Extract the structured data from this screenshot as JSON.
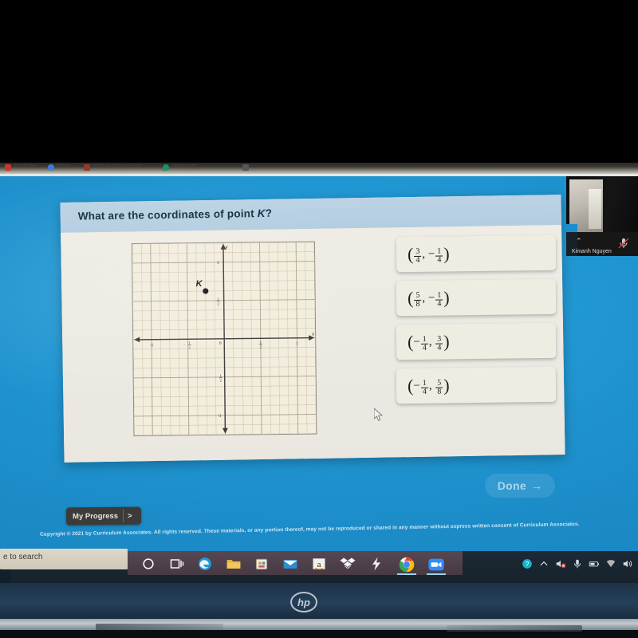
{
  "browser": {
    "bookmarks": [
      {
        "label": "YouTube",
        "icon": "youtube-icon",
        "color": "#c8372d"
      },
      {
        "label": "Maps",
        "icon": "maps-icon",
        "color": "#3b7ddd"
      },
      {
        "label": "Math Academy Link",
        "icon": "book-icon",
        "color": "#8d3b2e"
      },
      {
        "label": "iready.org",
        "icon": "iready-icon",
        "color": "#1f8f6a"
      },
      {
        "label": "",
        "icon": "folder-icon",
        "color": "#6b6b6b"
      }
    ]
  },
  "question": {
    "prompt_before": "What are the coordinates of point ",
    "prompt_var": "K",
    "prompt_after": "?"
  },
  "graph": {
    "x_axis_label": "x",
    "y_axis_label": "y",
    "x_ticks": [
      "-1",
      "-1/2",
      "0",
      "1/2",
      "1"
    ],
    "y_ticks": [
      "1",
      "1/2",
      "0",
      "-1/2",
      "-1"
    ],
    "point_label": "K",
    "point_x": -0.25,
    "point_y": 0.625,
    "grid_minor_step": 0.125,
    "grid_major_step": 0.5,
    "axis_min": -1.25,
    "axis_max": 1.25
  },
  "choices": [
    {
      "id": "a",
      "x_sign": "",
      "x_num": "3",
      "x_den": "4",
      "y_sign": "−",
      "y_num": "1",
      "y_den": "4"
    },
    {
      "id": "b",
      "x_sign": "",
      "x_num": "5",
      "x_den": "8",
      "y_sign": "−",
      "y_num": "1",
      "y_den": "4"
    },
    {
      "id": "c",
      "x_sign": "−",
      "x_num": "1",
      "x_den": "4",
      "y_sign": "",
      "y_num": "3",
      "y_den": "4"
    },
    {
      "id": "d",
      "x_sign": "−",
      "x_num": "1",
      "x_den": "4",
      "y_sign": "",
      "y_num": "5",
      "y_den": "8"
    }
  ],
  "footer": {
    "done_label": "Done",
    "done_arrow": "→",
    "progress_label": "My Progress",
    "progress_chevron": ">",
    "copyright": "Copyright © 2021 by Curriculum Associates. All rights reserved. These materials, or any portion thereof, may not be reproduced or shared in any manner without express written consent of Curriculum Associates."
  },
  "video_call": {
    "participant_name": "Kimanh Nguyen",
    "mic_state": "muted",
    "chevron": "⌃"
  },
  "taskbar": {
    "search_placeholder": "e to search",
    "apps": [
      {
        "name": "cortana-icon",
        "color": "#ffffff"
      },
      {
        "name": "task-view-icon",
        "color": "#ffffff"
      },
      {
        "name": "edge-icon",
        "color": "#2a8fc7"
      },
      {
        "name": "file-explorer-icon",
        "color": "#e8b33a"
      },
      {
        "name": "microsoft-store-icon",
        "color": "#e9e4d8"
      },
      {
        "name": "mail-icon",
        "color": "#1f8fd0"
      },
      {
        "name": "amazon-icon",
        "color": "#f1f1ee"
      },
      {
        "name": "dropbox-icon",
        "color": "#1a1a1a"
      },
      {
        "name": "thunderbolt-icon",
        "color": "#f0f0f0"
      },
      {
        "name": "chrome-icon",
        "color": "#4285f4"
      },
      {
        "name": "zoom-icon",
        "color": "#2d8cff"
      }
    ],
    "tray": [
      {
        "name": "help-icon"
      },
      {
        "name": "chevron-up-icon"
      },
      {
        "name": "speaker-muted-icon"
      },
      {
        "name": "microphone-icon"
      },
      {
        "name": "battery-icon"
      },
      {
        "name": "wifi-icon"
      },
      {
        "name": "volume-icon"
      }
    ]
  },
  "device": {
    "brand": "hp"
  }
}
